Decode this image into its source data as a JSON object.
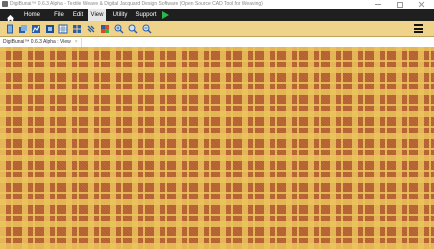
{
  "window": {
    "title": "DigiBunai™ 0.6.3 Alpha - Textile Weave & Digital Jacquard Design Software (Open Source CAD Tool for Weaving)",
    "controls": [
      "minimize",
      "maximize",
      "close"
    ]
  },
  "menu": {
    "home_icon": "home-icon",
    "items": [
      "Home Screen",
      "File",
      "Edit",
      "View",
      "Utility",
      "Support"
    ],
    "active": "View",
    "run_icon": "play-icon"
  },
  "toolbar": {
    "tools": [
      {
        "name": "composite-view-icon"
      },
      {
        "name": "grid-view-icon"
      },
      {
        "name": "graph-view-icon"
      },
      {
        "name": "front-view-icon"
      },
      {
        "name": "rear-view-icon"
      },
      {
        "name": "flip-view-icon"
      },
      {
        "name": "simulation-view-icon"
      },
      {
        "name": "tiling-view-icon"
      },
      {
        "name": "zoom-in-icon"
      },
      {
        "name": "zoom-normal-icon"
      },
      {
        "name": "zoom-out-icon"
      }
    ],
    "menu_icon": "hamburger-menu-icon"
  },
  "tab": {
    "label": "DigiBunai™ 0.6.3 Alpha : View",
    "close": "×"
  },
  "canvas": {
    "pattern": "tartan",
    "colors": {
      "base": "#c06a3a",
      "stripe": "#ecc45c",
      "dark": "#7a3c14"
    }
  }
}
